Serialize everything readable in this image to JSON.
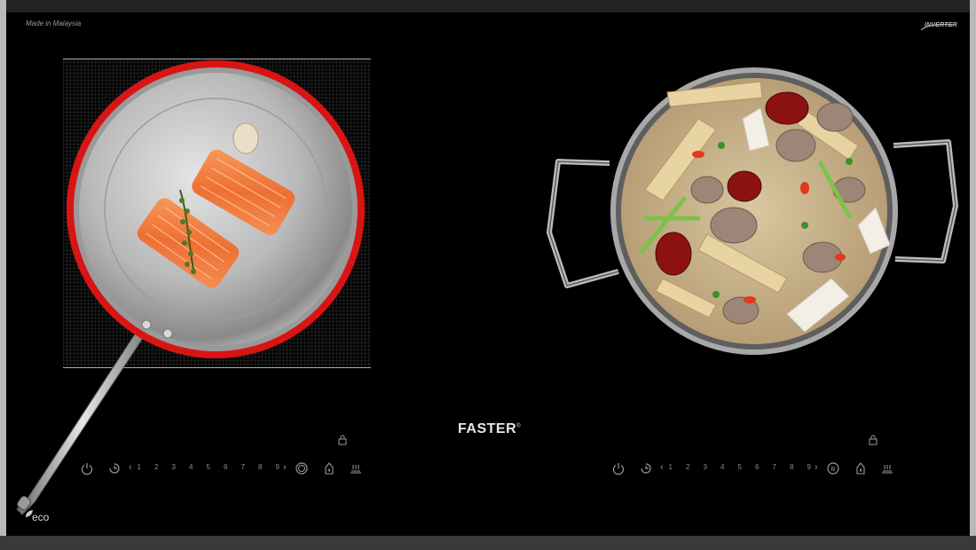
{
  "made_in": "Made in Malaysia",
  "inverter_logo": "INVERTER",
  "brand": {
    "name": "FASTER",
    "mark": "®"
  },
  "left_zone": {
    "power_levels": [
      "1",
      "2",
      "3",
      "4",
      "5",
      "6",
      "7",
      "8",
      "9"
    ],
    "icons": [
      "power-icon",
      "timer-icon",
      "boost-icon",
      "heat-icon",
      "keep-warm-icon",
      "lock-icon"
    ]
  },
  "right_zone": {
    "power_levels": [
      "1",
      "2",
      "3",
      "4",
      "5",
      "6",
      "7",
      "8",
      "9"
    ],
    "icons": [
      "power-icon",
      "timer-icon",
      "boost-icon",
      "heat-icon",
      "keep-warm-icon",
      "lock-icon"
    ]
  },
  "eco_label": "eco",
  "colors": {
    "glass": "#000000",
    "pan_red": "#e01818",
    "steel": "#c8c8c8",
    "salmon": "#f07a3c",
    "grid_line": "#aaaaaa",
    "control_grey": "#8c8c8c"
  }
}
